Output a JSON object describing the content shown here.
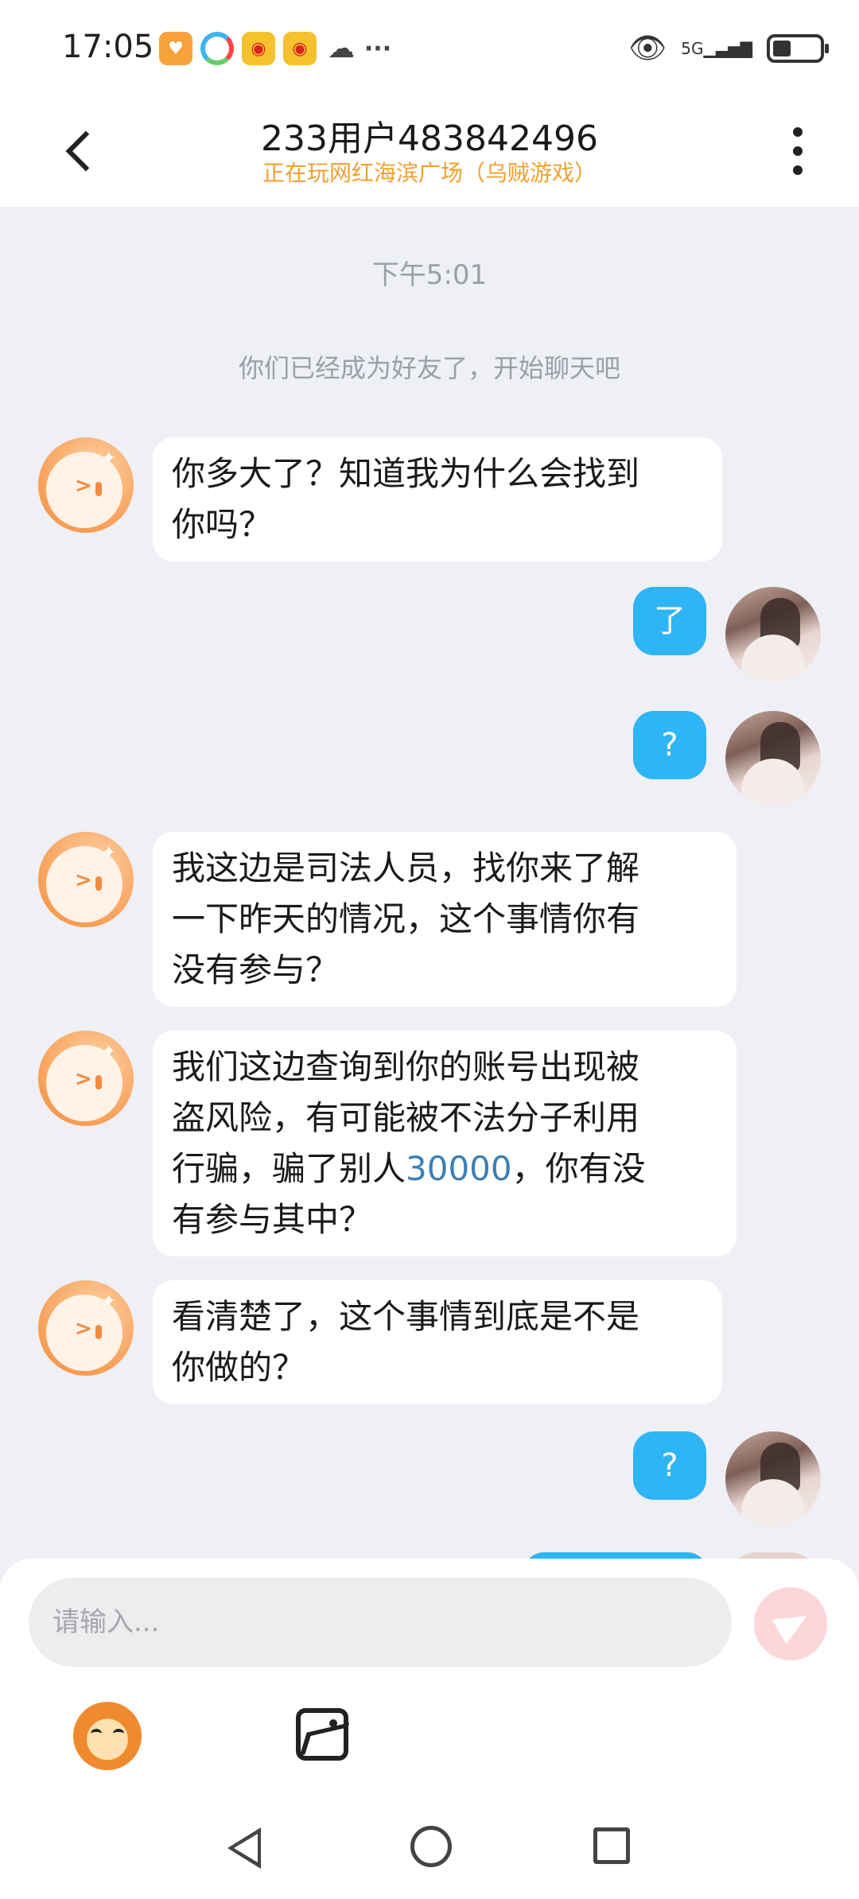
{
  "status_bar": {
    "time": "17:05",
    "network": "5G",
    "icons": [
      "orange-app-icon",
      "multicolor-app-icon",
      "weibo-icon",
      "weibo-icon",
      "wechat-icon",
      "more-notifications-icon",
      "eye-icon",
      "signal-icon",
      "battery-icon"
    ]
  },
  "header": {
    "title": "233用户483842496",
    "subtitle": "正在玩网红海滨广场（乌贼游戏）",
    "accent_color": "#f0a032"
  },
  "chat": {
    "timestamp": "下午5:01",
    "system_message": "你们已经成为好友了，开始聊天吧",
    "messages": [
      {
        "side": "left",
        "lines": [
          "你多大了？知道我为什么会找到",
          "你吗？"
        ]
      },
      {
        "side": "right",
        "text": "了"
      },
      {
        "side": "right",
        "text": "?"
      },
      {
        "side": "left",
        "lines": [
          "我这边是司法人员，找你来了解",
          "一下昨天的情况，这个事情你有",
          "没有参与？"
        ]
      },
      {
        "side": "left",
        "lines_before": "我们这边查询到你的账号出现被\n盗风险，有可能被不法分子利用\n行骗，骗了别人",
        "amount": "30000",
        "lines_after": "，你有没\n有参与其中？"
      },
      {
        "side": "left",
        "lines": [
          "看清楚了，这个事情到底是不是",
          "你做的？"
        ]
      },
      {
        "side": "right",
        "text": "?"
      }
    ],
    "bubble_colors": {
      "outgoing": "#2db5f5",
      "incoming": "#ffffff",
      "amount_link": "#3d7fb5"
    }
  },
  "composer": {
    "placeholder": "请输入...",
    "send_button_color": "#fcd6d8"
  }
}
